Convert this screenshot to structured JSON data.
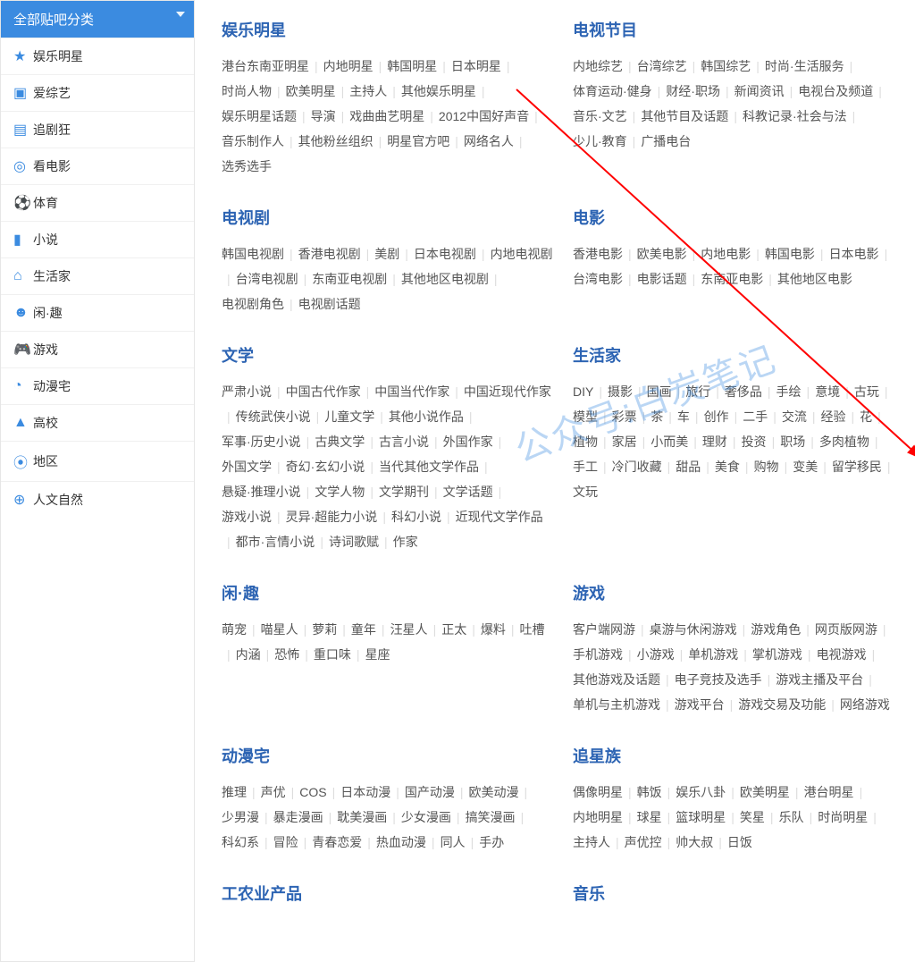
{
  "sidebar": {
    "header": "全部贴吧分类",
    "items": [
      {
        "icon": "★",
        "label": "娱乐明星"
      },
      {
        "icon": "▣",
        "label": "爱综艺"
      },
      {
        "icon": "▤",
        "label": "追剧狂"
      },
      {
        "icon": "◎",
        "label": "看电影"
      },
      {
        "icon": "⚽",
        "label": "体育"
      },
      {
        "icon": "▮",
        "label": "小说"
      },
      {
        "icon": "⌂",
        "label": "生活家"
      },
      {
        "icon": "☻",
        "label": "闲·趣"
      },
      {
        "icon": "🎮",
        "label": "游戏"
      },
      {
        "icon": "◔",
        "label": "动漫宅"
      },
      {
        "icon": "▲",
        "label": "高校"
      },
      {
        "icon": "⦿",
        "label": "地区"
      },
      {
        "icon": "⊕",
        "label": "人文自然"
      }
    ]
  },
  "watermark": "公众号:白炭笔记",
  "sections": [
    {
      "cols": [
        {
          "title": "娱乐明星",
          "tags": [
            "港台东南亚明星",
            "内地明星",
            "韩国明星",
            "日本明星",
            "时尚人物",
            "欧美明星",
            "主持人",
            "其他娱乐明星",
            "娱乐明星话题",
            "导演",
            "戏曲曲艺明星",
            "2012中国好声音",
            "音乐制作人",
            "其他粉丝组织",
            "明星官方吧",
            "网络名人",
            "选秀选手"
          ]
        },
        {
          "title": "电视节目",
          "tags": [
            "内地综艺",
            "台湾综艺",
            "韩国综艺",
            "时尚·生活服务",
            "体育运动·健身",
            "财经·职场",
            "新闻资讯",
            "电视台及频道",
            "音乐·文艺",
            "其他节目及话题",
            "科教记录·社会与法",
            "少儿·教育",
            "广播电台"
          ]
        }
      ]
    },
    {
      "cols": [
        {
          "title": "电视剧",
          "tags": [
            "韩国电视剧",
            "香港电视剧",
            "美剧",
            "日本电视剧",
            "内地电视剧",
            "台湾电视剧",
            "东南亚电视剧",
            "其他地区电视剧",
            "电视剧角色",
            "电视剧话题"
          ]
        },
        {
          "title": "电影",
          "tags": [
            "香港电影",
            "欧美电影",
            "内地电影",
            "韩国电影",
            "日本电影",
            "台湾电影",
            "电影话题",
            "东南亚电影",
            "其他地区电影"
          ]
        }
      ]
    },
    {
      "cols": [
        {
          "title": "文学",
          "tags": [
            "严肃小说",
            "中国古代作家",
            "中国当代作家",
            "中国近现代作家",
            "传统武侠小说",
            "儿童文学",
            "其他小说作品",
            "军事·历史小说",
            "古典文学",
            "古言小说",
            "外国作家",
            "外国文学",
            "奇幻·玄幻小说",
            "当代其他文学作品",
            "悬疑·推理小说",
            "文学人物",
            "文学期刊",
            "文学话题",
            "游戏小说",
            "灵异·超能力小说",
            "科幻小说",
            "近现代文学作品",
            "都市·言情小说",
            "诗词歌赋",
            "作家"
          ]
        },
        {
          "title": "生活家",
          "tags": [
            "DIY",
            "摄影",
            "国画",
            "旅行",
            "奢侈品",
            "手绘",
            "意境",
            "古玩",
            "模型",
            "彩票",
            "茶",
            "车",
            "创作",
            "二手",
            "交流",
            "经验",
            "花",
            "植物",
            "家居",
            "小而美",
            "理财",
            "投资",
            "职场",
            "多肉植物",
            "手工",
            "冷门收藏",
            "甜品",
            "美食",
            "购物",
            "变美",
            "留学移民",
            "文玩"
          ]
        }
      ]
    },
    {
      "cols": [
        {
          "title": "闲·趣",
          "tags": [
            "萌宠",
            "喵星人",
            "萝莉",
            "童年",
            "汪星人",
            "正太",
            "爆料",
            "吐槽",
            "内涵",
            "恐怖",
            "重口味",
            "星座"
          ]
        },
        {
          "title": "游戏",
          "tags": [
            "客户端网游",
            "桌游与休闲游戏",
            "游戏角色",
            "网页版网游",
            "手机游戏",
            "小游戏",
            "单机游戏",
            "掌机游戏",
            "电视游戏",
            "其他游戏及话题",
            "电子竞技及选手",
            "游戏主播及平台",
            "单机与主机游戏",
            "游戏平台",
            "游戏交易及功能",
            "网络游戏"
          ]
        }
      ]
    },
    {
      "cols": [
        {
          "title": "动漫宅",
          "tags": [
            "推理",
            "声优",
            "COS",
            "日本动漫",
            "国产动漫",
            "欧美动漫",
            "少男漫",
            "暴走漫画",
            "耽美漫画",
            "少女漫画",
            "搞笑漫画",
            "科幻系",
            "冒险",
            "青春恋爱",
            "热血动漫",
            "同人",
            "手办"
          ]
        },
        {
          "title": "追星族",
          "tags": [
            "偶像明星",
            "韩饭",
            "娱乐八卦",
            "欧美明星",
            "港台明星",
            "内地明星",
            "球星",
            "篮球明星",
            "笑星",
            "乐队",
            "时尚明星",
            "主持人",
            "声优控",
            "帅大叔",
            "日饭"
          ]
        }
      ]
    },
    {
      "cols": [
        {
          "title": "工农业产品",
          "tags": []
        },
        {
          "title": "音乐",
          "tags": []
        }
      ]
    }
  ]
}
